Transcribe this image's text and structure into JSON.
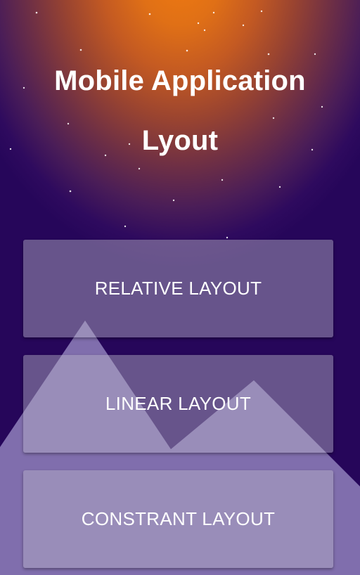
{
  "header": {
    "title_line1": "Mobile Application",
    "title_line2": "Lyout"
  },
  "buttons": {
    "relative_label": "RELATIVE LAYOUT",
    "linear_label": "LINEAR LAYOUT",
    "constraint_label": "CONSTRANT LAYOUT"
  },
  "colors": {
    "glow": "#f07a10",
    "sky": "#26065a",
    "mountain": "#9a8cc4"
  }
}
